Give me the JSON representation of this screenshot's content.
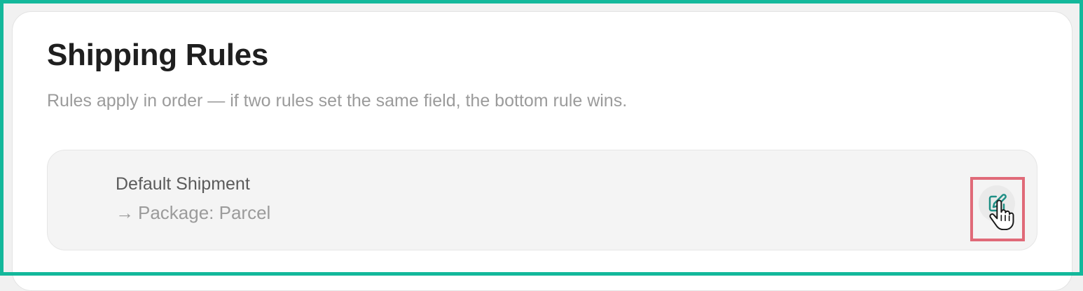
{
  "page": {
    "title": "Shipping Rules",
    "subtitle": "Rules apply in order — if two rules set the same field, the bottom rule wins."
  },
  "rules": [
    {
      "name": "Default Shipment",
      "effect_arrow": "→",
      "effect_text": "Package: Parcel",
      "action_icon": "edit-icon"
    }
  ],
  "colors": {
    "frame": "#13b89b",
    "accent": "#1f8f85",
    "highlight": "#e06a78"
  }
}
